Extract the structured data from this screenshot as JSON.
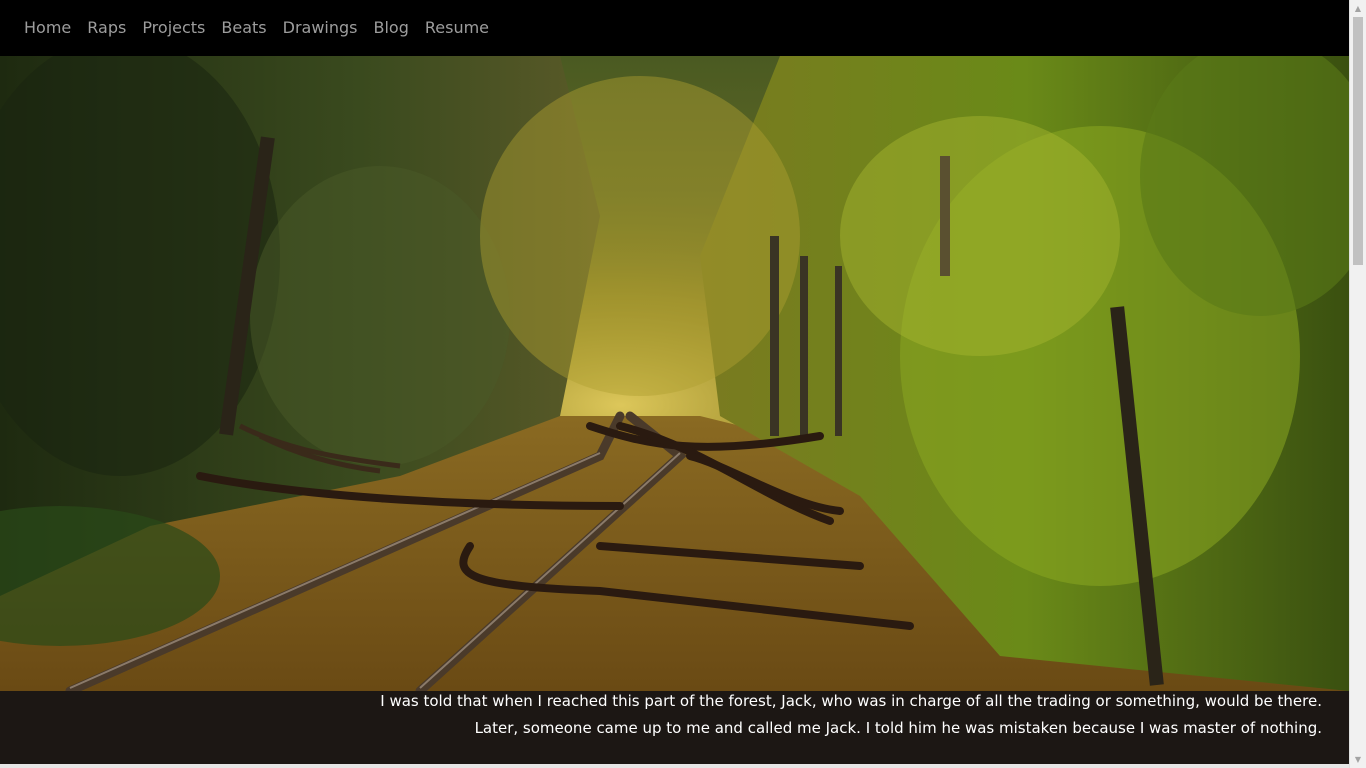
{
  "nav": {
    "items": [
      {
        "label": "Home"
      },
      {
        "label": "Raps"
      },
      {
        "label": "Projects"
      },
      {
        "label": "Beats"
      },
      {
        "label": "Drawings"
      },
      {
        "label": "Blog"
      },
      {
        "label": "Resume"
      }
    ]
  },
  "hero": {
    "image": "autumn-forest-railway-tracks"
  },
  "caption": {
    "line1": "I was told that when I reached this part of the forest, Jack, who was in charge of all the trading or something, would be there.",
    "line2": "Later, someone came up to me and called me Jack. I told him he was mistaken because I was master of nothing."
  },
  "colors": {
    "nav_bg": "#000000",
    "nav_text": "#9d9d9d",
    "caption_bg": "#1c1714",
    "caption_text": "#ffffff"
  },
  "scrollbar": {
    "up_icon": "chevron-up-icon",
    "down_icon": "chevron-down-icon"
  }
}
